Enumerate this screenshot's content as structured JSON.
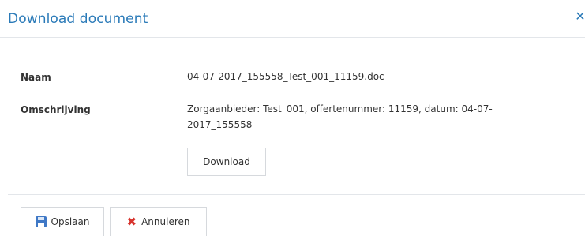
{
  "dialog": {
    "title": "Download document",
    "close_icon": "close-icon"
  },
  "fields": [
    {
      "label": "Naam",
      "value": "04-07-2017_155558_Test_001_11159.doc"
    },
    {
      "label": "Omschrijving",
      "value": "Zorgaanbieder: Test_001, offertenummer: 11159, datum: 04-07-2017_155558"
    }
  ],
  "actions": {
    "download_label": "Download"
  },
  "footer": {
    "save_label": "Opslaan",
    "save_icon": "floppy-disk-icon",
    "cancel_label": "Annuleren",
    "cancel_icon": "red-x-icon"
  },
  "colors": {
    "title": "#2a7ab8",
    "border": "#d6d9dd",
    "cancel_icon": "#d7332d",
    "save_icon": "#3f78c6"
  }
}
